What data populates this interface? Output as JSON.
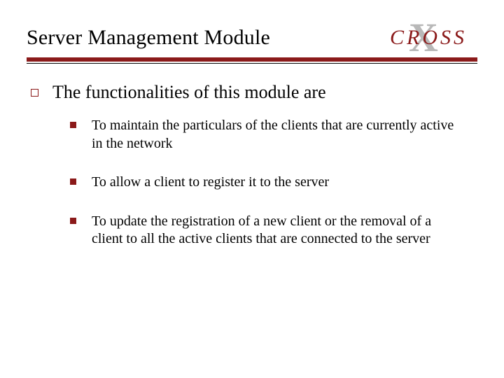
{
  "title": "Server Management Module",
  "logo": {
    "text": "CROSS",
    "bg_letter": "X"
  },
  "main": {
    "heading": "The functionalities of this module are",
    "items": [
      "To maintain the particulars of the clients that are currently active in the network",
      "To allow a client to register it to the server",
      "To update the registration of a new client or the removal of a client to all the active clients that are connected to the server"
    ]
  }
}
